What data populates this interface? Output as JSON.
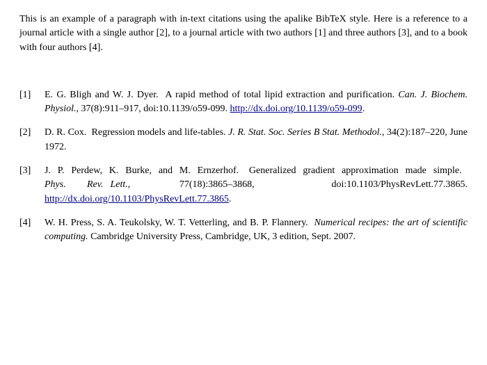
{
  "paragraph": {
    "text": "This is an example of a paragraph with in-text citations using the apalike BibTeX style.  Here is a reference to a journal article with a single author [2], to a journal article with two authors [1] and three authors [3], and to a book with four authors [4]."
  },
  "references": {
    "items": [
      {
        "label": "[1]",
        "content_html": "E. G. Bligh and W. J. Dyer.  A rapid method of total lipid extraction and purification. <em>Can. J. Biochem. Physiol.</em>, 37(8):911–917, doi:10.1139/o59-099. <span class=\"url\">http://dx.doi.org/10.1139/o59-099</span>."
      },
      {
        "label": "[2]",
        "content_html": "D. R. Cox.  Regression models and life-tables. <em>J. R. Stat. Soc. Series B Stat. Methodol.</em>, 34(2):187–220, June 1972."
      },
      {
        "label": "[3]",
        "content_html": "J. P. Perdew, K. Burke, and M. Ernzerhof. Generalized gradient approximation made simple. <em>Phys. Rev. Lett.</em>, 77(18):3865–3868, doi:10.1103/PhysRevLett.77.3865. <span class=\"url\">http://dx.doi.org/10.1103/PhysRevLett.77.3865</span>."
      },
      {
        "label": "[4]",
        "content_html": "W. H. Press, S. A. Teukolsky, W. T. Vetterling, and B. P. Flannery. <em>Numerical recipes: the art of scientific computing.</em> Cambridge University Press, Cambridge, UK, 3 edition, Sept. 2007."
      }
    ]
  }
}
